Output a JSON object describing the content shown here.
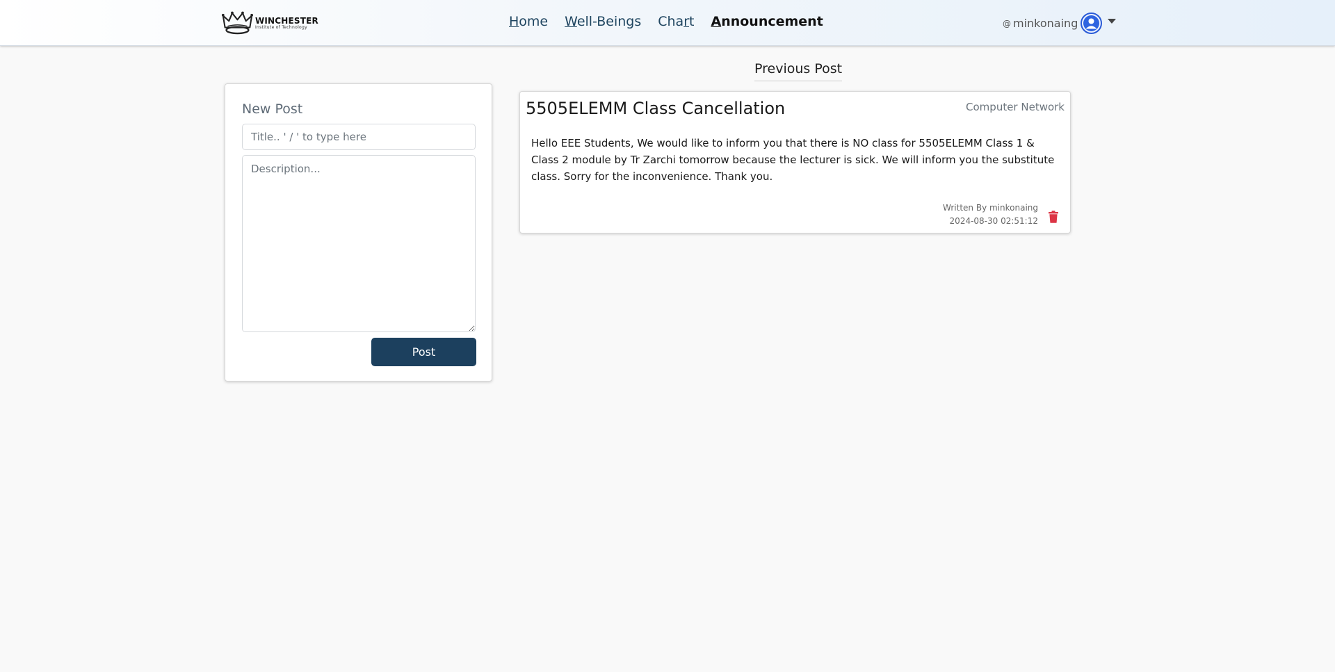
{
  "brand": {
    "name": "WINCHESTER",
    "subtitle": "Institute of Technology"
  },
  "nav": {
    "items": [
      {
        "first": "H",
        "rest": "ome"
      },
      {
        "first": "W",
        "rest": "ell-Beings"
      },
      {
        "first": "Cha",
        "underline": "r",
        "rest": "t"
      },
      {
        "first": "A",
        "rest": "nnouncement"
      }
    ]
  },
  "user": {
    "at": "@",
    "name": "minkonaing"
  },
  "new_post": {
    "heading": "New Post",
    "title_placeholder": "Title.. ' / ' to type here",
    "description_placeholder": "Description...",
    "post_label": "Post"
  },
  "previous": {
    "heading": "Previous Post",
    "posts": [
      {
        "title": "5505ELEMM Class Cancellation",
        "category": "Computer Network",
        "body": "Hello EEE Students, We would like to inform you that there is NO class for 5505ELEMM Class 1 & Class 2 module by Tr Zarchi tomorrow because the lecturer is sick. We will inform you the substitute class. Sorry for the inconvenience. Thank you.",
        "written_by": "Written By minkonaing",
        "timestamp": "2024-08-30 02:51:12"
      }
    ]
  },
  "colors": {
    "primary_button": "#1c405e",
    "nav_link": "#1f4560",
    "delete": "#dc3545",
    "avatar": "#2f64e0"
  }
}
